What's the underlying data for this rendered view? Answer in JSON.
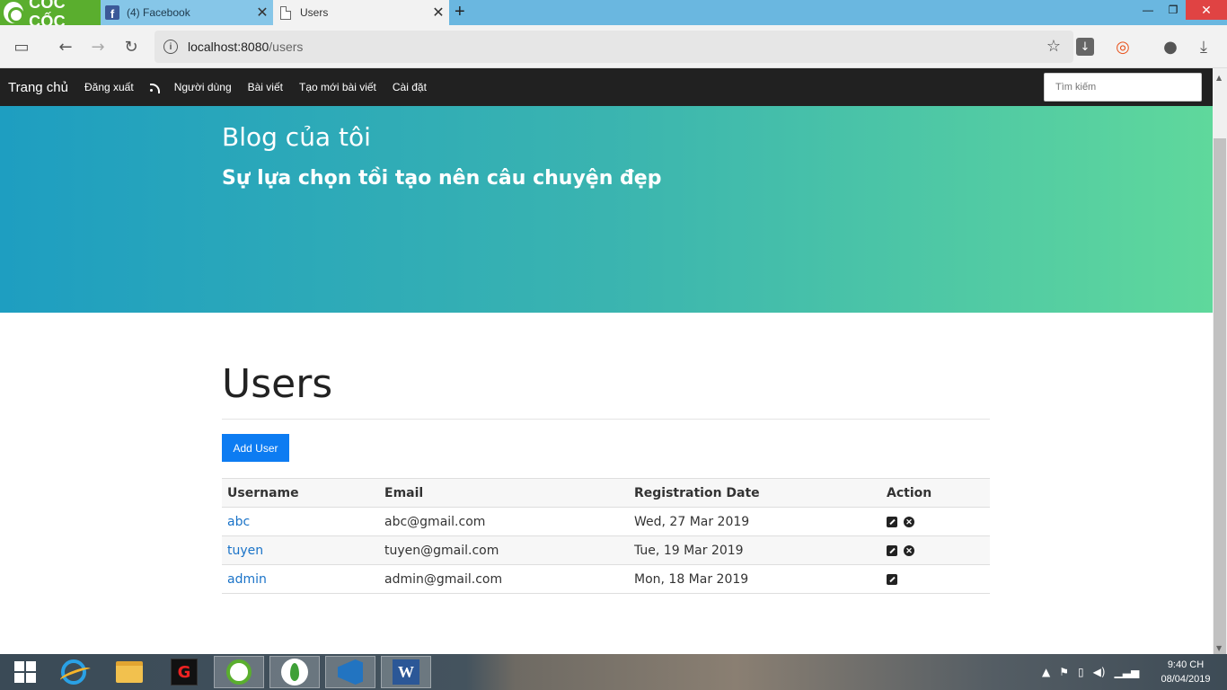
{
  "browser": {
    "brand": "CỐC CỐC",
    "tabs": [
      {
        "title": "(4) Facebook",
        "active": false
      },
      {
        "title": "Users",
        "active": true
      }
    ],
    "url_host": "localhost:8080",
    "url_path": "/users"
  },
  "navbar": {
    "brand": "Trang chủ",
    "links": [
      "Đăng xuất",
      "Người dùng",
      "Bài viết",
      "Tạo mới bài viết",
      "Cài đặt"
    ],
    "search_placeholder": "Tìm kiếm"
  },
  "hero": {
    "title": "Blog của tôi",
    "subtitle": "Sự lựa chọn tồi tạo nên câu chuyện đẹp",
    "gradient": [
      "#1e9ec1",
      "#5fd89c"
    ]
  },
  "page": {
    "title": "Users",
    "add_button": "Add User",
    "accent": "#0d7cf2"
  },
  "table": {
    "headers": [
      "Username",
      "Email",
      "Registration Date",
      "Action"
    ],
    "rows": [
      {
        "username": "abc",
        "email": "abc@gmail.com",
        "date": "Wed, 27 Mar 2019",
        "actions": [
          "edit-icon",
          "delete-icon"
        ]
      },
      {
        "username": "tuyen",
        "email": "tuyen@gmail.com",
        "date": "Tue, 19 Mar 2019",
        "actions": [
          "edit-icon",
          "delete-icon"
        ]
      },
      {
        "username": "admin",
        "email": "admin@gmail.com",
        "date": "Mon, 18 Mar 2019",
        "actions": [
          "edit-icon"
        ]
      }
    ]
  },
  "taskbar": {
    "time": "9:40 CH",
    "date": "08/04/2019",
    "apps": [
      "windows-start",
      "internet-explorer",
      "file-explorer",
      "garena",
      "coccoc-browser",
      "mongodb-compass",
      "vscode",
      "word"
    ]
  }
}
